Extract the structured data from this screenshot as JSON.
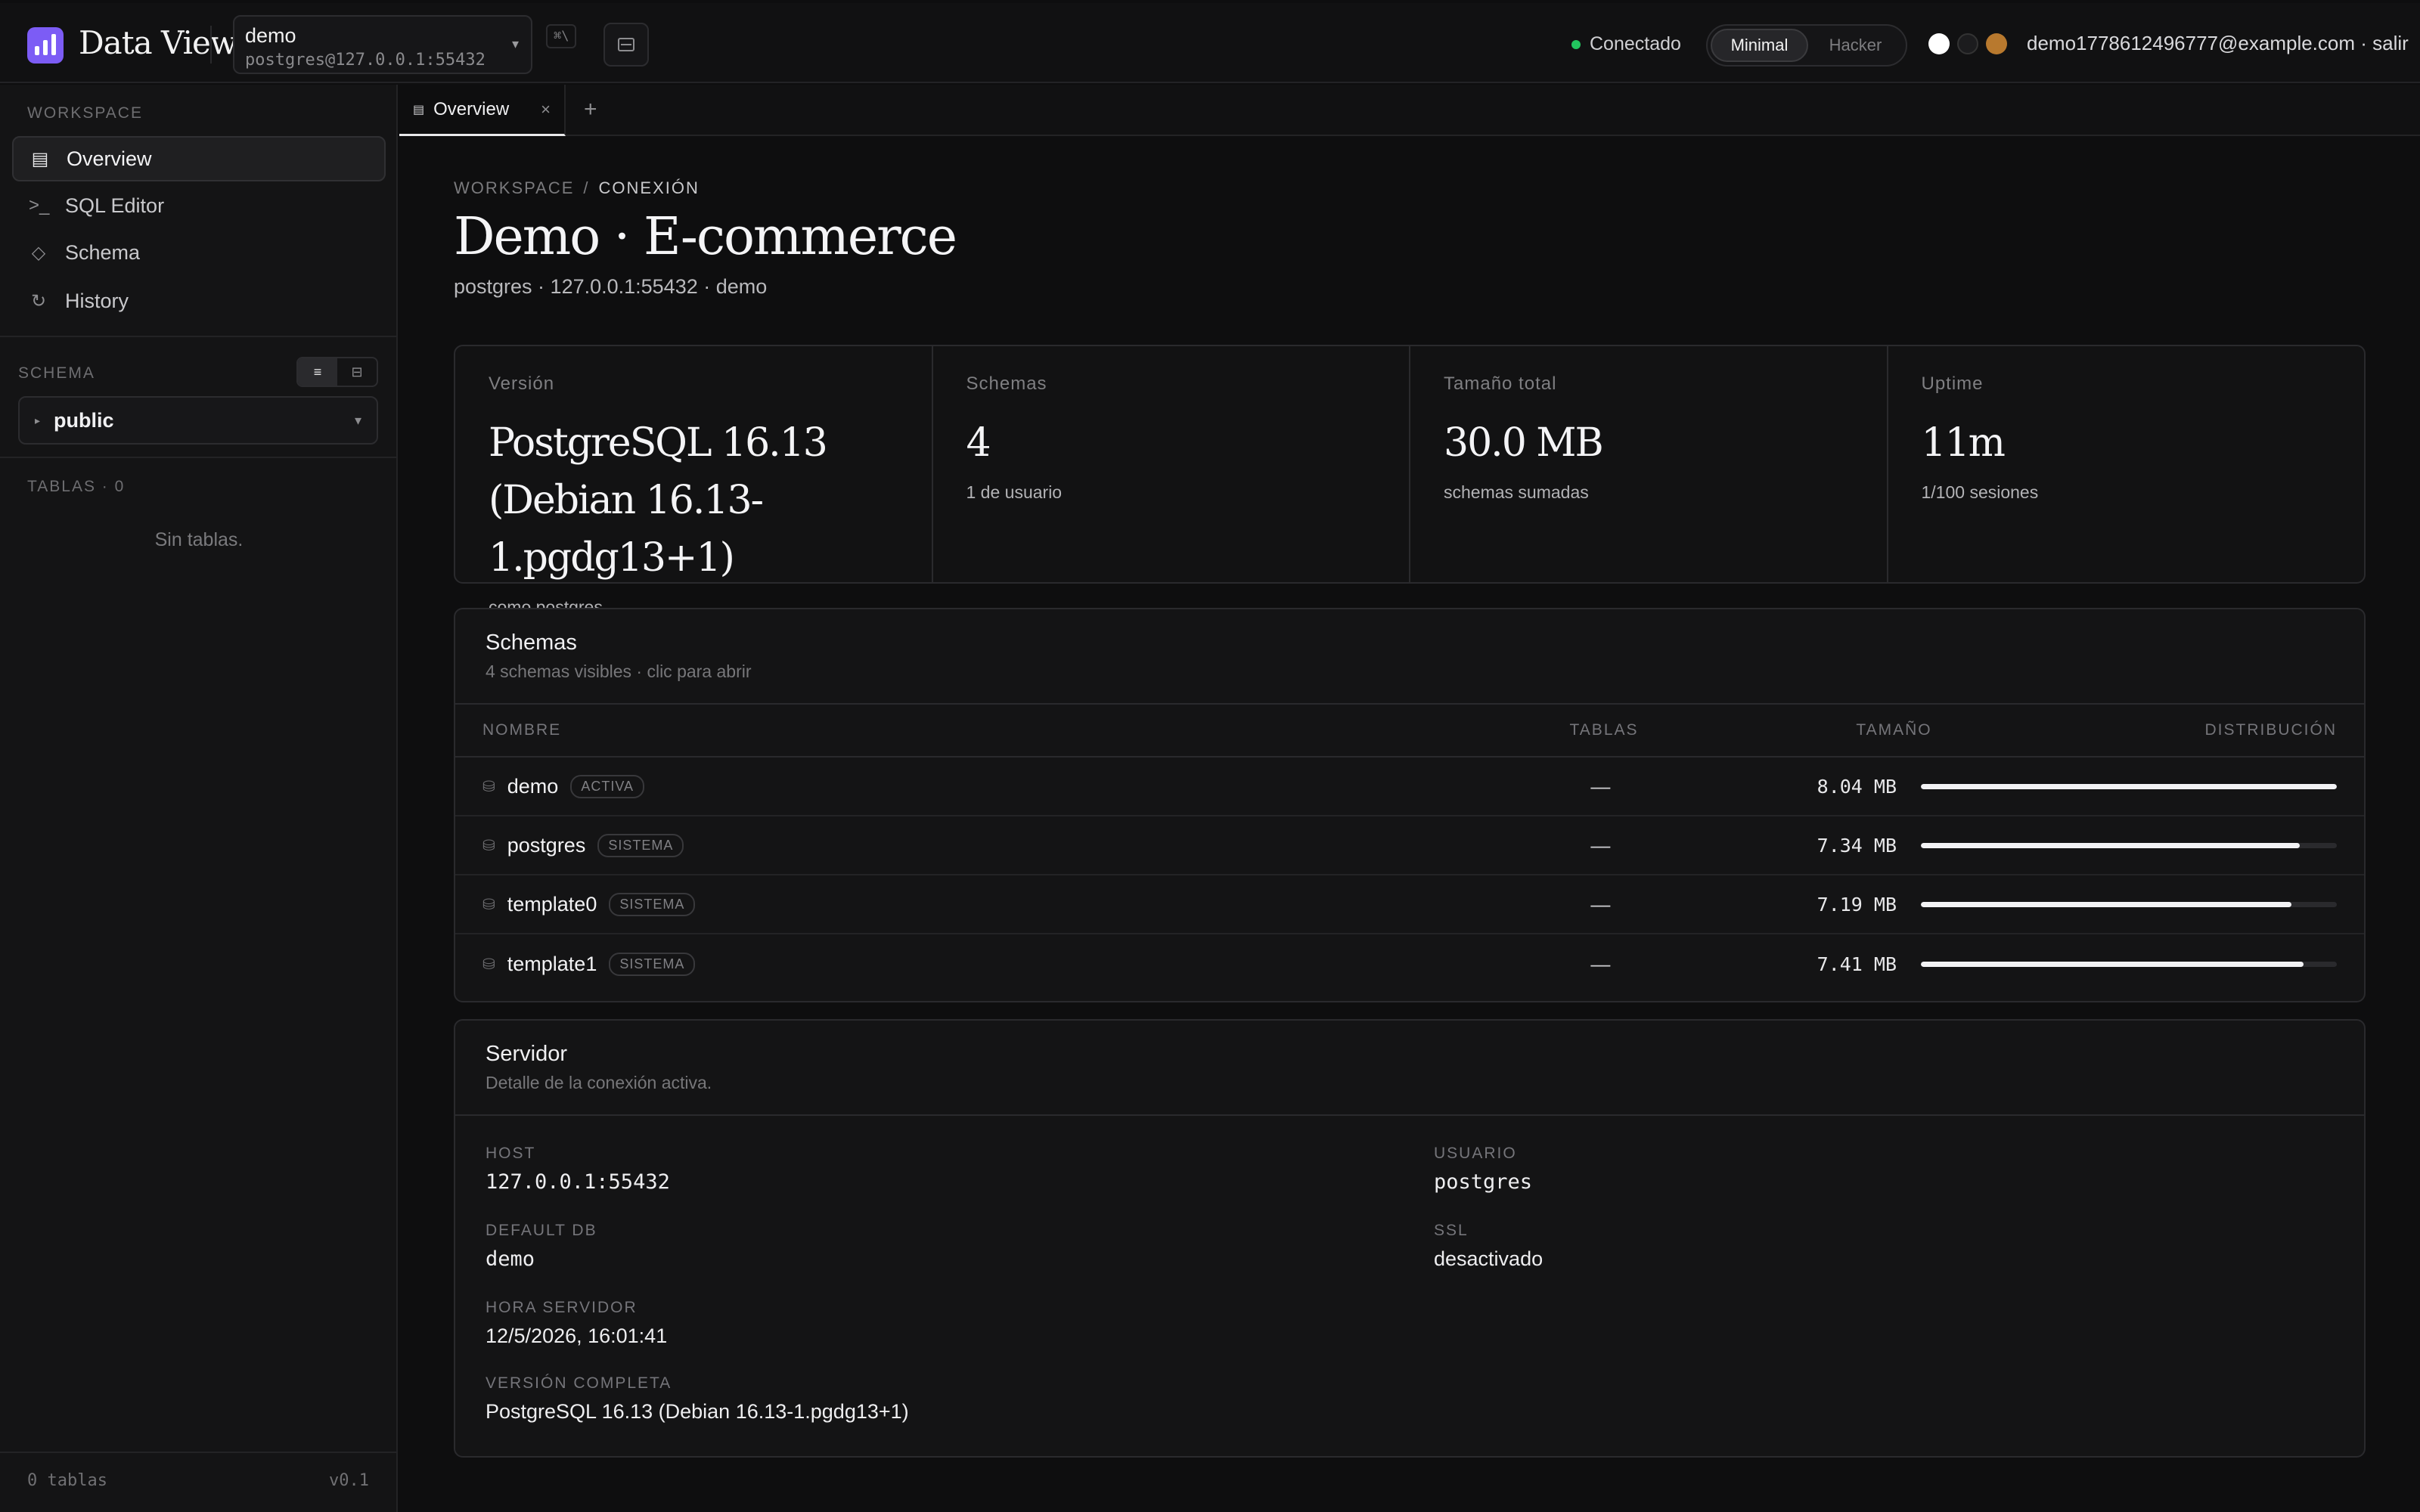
{
  "app": {
    "title": "Data View"
  },
  "connection": {
    "name": "demo",
    "detail": "postgres@127.0.0.1:55432",
    "shortcut": "⌘\\"
  },
  "status": {
    "label": "Conectado",
    "color": "#22c55e"
  },
  "theme": {
    "options": [
      "Minimal",
      "Hacker"
    ],
    "selected": "Minimal",
    "swatches": [
      "#ffffff",
      "#1c1c1e",
      "#b8792e"
    ]
  },
  "user": {
    "line": "demo1778612496777@example.com · salir"
  },
  "sidebar": {
    "workspace_label": "WORKSPACE",
    "items": [
      {
        "label": "Overview",
        "icon": "table-icon",
        "glyph": "▤",
        "active": true
      },
      {
        "label": "SQL Editor",
        "icon": "terminal-icon",
        "glyph": ">_",
        "active": false
      },
      {
        "label": "Schema",
        "icon": "diamond-icon",
        "glyph": "◇",
        "active": false
      },
      {
        "label": "History",
        "icon": "history-icon",
        "glyph": "↻",
        "active": false
      }
    ],
    "schema_label": "SCHEMA",
    "schema_value": "public",
    "tables_label": "TABLAS · 0",
    "empty_text": "Sin tablas.",
    "footer_left": "0 tablas",
    "footer_right": "v0.1"
  },
  "tabs": [
    {
      "label": "Overview"
    }
  ],
  "breadcrumb": {
    "root": "WORKSPACE",
    "current": "CONEXIÓN"
  },
  "page": {
    "title": "Demo · E-commerce",
    "subtitle": "postgres · 127.0.0.1:55432 · demo"
  },
  "stats": [
    {
      "label": "Versión",
      "value": "PostgreSQL 16.13 (Debian 16.13-1.pgdg13+1)",
      "note": "como postgres"
    },
    {
      "label": "Schemas",
      "value": "4",
      "note": "1 de usuario"
    },
    {
      "label": "Tamaño total",
      "value": "30.0 MB",
      "note": "schemas sumadas"
    },
    {
      "label": "Uptime",
      "value": "11m",
      "note": "1/100 sesiones"
    }
  ],
  "schemas_card": {
    "title": "Schemas",
    "subtitle": "4 schemas visibles · clic para abrir",
    "columns": [
      "NOMBRE",
      "TABLAS",
      "TAMAÑO",
      "DISTRIBUCIÓN"
    ],
    "rows": [
      {
        "name": "demo",
        "badge": "ACTIVA",
        "tables": "—",
        "size": "8.04 MB",
        "dist": 1.0
      },
      {
        "name": "postgres",
        "badge": "SISTEMA",
        "tables": "—",
        "size": "7.34 MB",
        "dist": 0.91
      },
      {
        "name": "template0",
        "badge": "SISTEMA",
        "tables": "—",
        "size": "7.19 MB",
        "dist": 0.89
      },
      {
        "name": "template1",
        "badge": "SISTEMA",
        "tables": "—",
        "size": "7.41 MB",
        "dist": 0.92
      }
    ]
  },
  "server_card": {
    "title": "Servidor",
    "subtitle": "Detalle de la conexión activa.",
    "host_label": "HOST",
    "host": "127.0.0.1:55432",
    "user_label": "USUARIO",
    "user": "postgres",
    "db_label": "DEFAULT DB",
    "db": "demo",
    "ssl_label": "SSL",
    "ssl": "desactivado",
    "time_label": "HORA SERVIDOR",
    "time": "12/5/2026, 16:01:41",
    "version_label": "VERSIÓN COMPLETA",
    "version": "PostgreSQL 16.13 (Debian 16.13-1.pgdg13+1)"
  }
}
